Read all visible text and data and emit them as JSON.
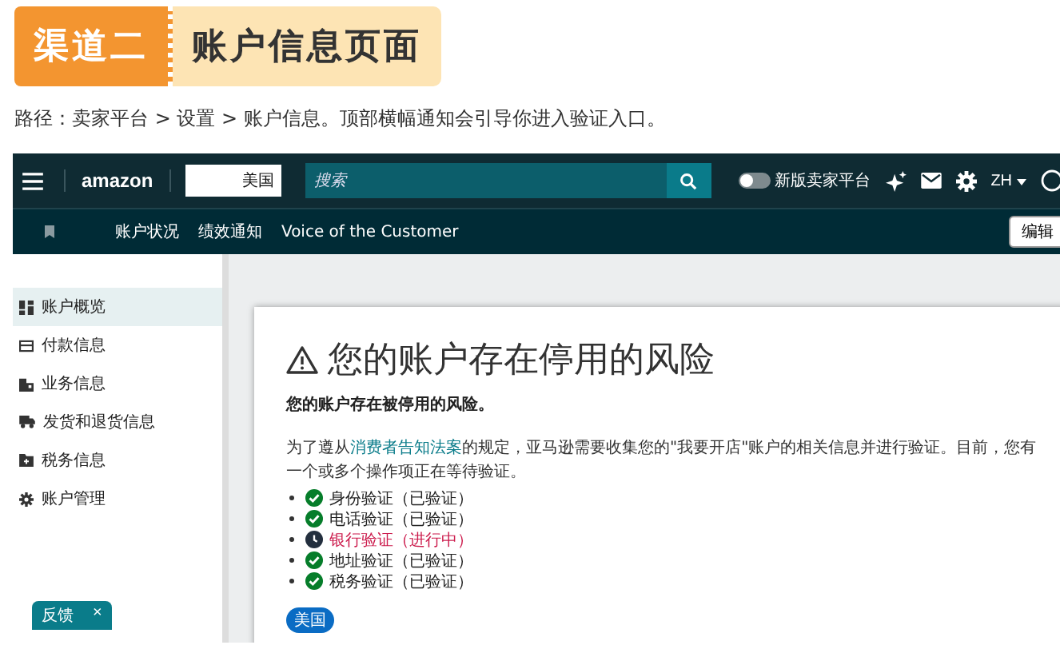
{
  "banner": {
    "tag": "渠道二",
    "title": "账户信息页面"
  },
  "path_text": "路径：卖家平台 > 设置 > 账户信息。顶部横幅通知会引导你进入验证入口。",
  "topbar": {
    "logo": "amazon",
    "country": "美国",
    "search": {
      "placeholder": "搜索"
    },
    "toggle": {
      "label": "新版卖家平台",
      "on": false
    },
    "language": "ZH"
  },
  "subnav": {
    "links": [
      "账户状况",
      "绩效通知",
      "Voice of the Customer"
    ],
    "edit_button": "编辑"
  },
  "sidebar": {
    "items": [
      {
        "label": "账户概览",
        "kind": "grid",
        "selected": true
      },
      {
        "label": "付款信息",
        "kind": "card",
        "selected": false
      },
      {
        "label": "业务信息",
        "kind": "building",
        "selected": false
      },
      {
        "label": "发货和退货信息",
        "kind": "truck",
        "selected": false
      },
      {
        "label": "税务信息",
        "kind": "folder",
        "selected": false
      },
      {
        "label": "账户管理",
        "kind": "gear",
        "selected": false
      }
    ],
    "feedback": {
      "label": "反馈",
      "close": "×"
    }
  },
  "card": {
    "title": "您的账户存在停用的风险",
    "subtitle": "您的账户存在被停用的风险。",
    "notice": {
      "before": "为了遵从",
      "link": "消费者告知法案",
      "after": "的规定，亚马逊需要收集您的\"我要开店\"账户的相关信息并进行验证。目前，您有一个或多个操作项正在等待验证。"
    },
    "checks": [
      {
        "label": "身份验证（已验证）",
        "kind": "done"
      },
      {
        "label": "电话验证（已验证）",
        "kind": "done"
      },
      {
        "label": "银行验证（进行中）",
        "kind": "pending"
      },
      {
        "label": "地址验证（已验证）",
        "kind": "done"
      },
      {
        "label": "税务验证（已验证）",
        "kind": "done"
      }
    ],
    "region_badge": "美国"
  }
}
